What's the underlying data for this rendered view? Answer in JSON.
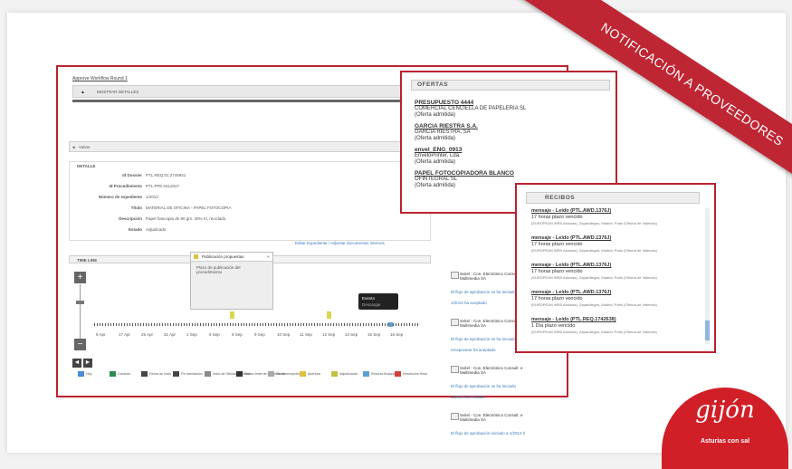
{
  "ribbon": {
    "text": "NOTIFICACIÓN A PROVEEDORES"
  },
  "workflow": {
    "header": "Approve Workflow Round 1",
    "toggle": "MOSTRAR DETALLES",
    "back": "Volver"
  },
  "detalle": {
    "title": "DETALLE",
    "rows": [
      {
        "label": "Id Dossier",
        "value": "PTL.REQ.01.2745941"
      },
      {
        "label": "Id Procedimiento",
        "value": "PTL.PFE.0412047"
      },
      {
        "label": "Número de expediente",
        "value": "1/2013"
      },
      {
        "label": "Título",
        "value": "MATERIAL DE OFICINA - PAPEL FOTOCOPIA"
      },
      {
        "label": "Descripción",
        "value": "Papel fotocopia de 80 grs. 30% Kl, reciclado"
      },
      {
        "label": "Estado",
        "value": "Adjudicado"
      }
    ],
    "link": "Editar Expediente / Adjuntar documentos internos"
  },
  "timeline": {
    "title": "TIME LINE",
    "right": "Modificar",
    "popup_title": "Publicación propuestas",
    "popup_body": "Plazo de publicación del procedimiento",
    "event_title": "Evento",
    "event_body": "Descargar",
    "dates": [
      "9 Apr",
      "17 Apr",
      "25 Apr",
      "31 Apr",
      "1 Sep",
      "9 Sep",
      "9 Sep",
      "9 Sep",
      "10 Sep",
      "11 Sep",
      "12 Sep",
      "14 Sep",
      "15 Sep",
      "16 Sep"
    ],
    "legend": [
      {
        "label": "Hoy",
        "color": "#4a8bd6"
      },
      {
        "label": "Creación",
        "color": "#2e8b57"
      },
      {
        "label": "Fecha de inicio",
        "color": "#444444"
      },
      {
        "label": "Fin tramitación",
        "color": "#444444"
      },
      {
        "label": "Inicio de Ofertas recibidas",
        "color": "#888888"
      },
      {
        "label": "Fecha límite de presentación",
        "color": "#333333"
      },
      {
        "label": "Fin de recepción",
        "color": "#aaaaaa"
      },
      {
        "label": "Apertura",
        "color": "#e0c040"
      },
      {
        "label": "Adjudicación",
        "color": "#c0c040"
      },
      {
        "label": "Recurso finalizado",
        "color": "#5aa0d0"
      },
      {
        "label": "Resolución firma",
        "color": "#d04040"
      }
    ]
  },
  "ofertas": {
    "title": "OFERTAS",
    "items": [
      {
        "name": "PRESUPUESTO 4444",
        "company": "COMERCIAL CENCIELLA DE PAPELERIA SL",
        "status": "(Oferta admitida)"
      },
      {
        "name": "GARCIA RIESTRA S.A.",
        "company": "GARCIA RIESTRA, SA",
        "status": "(Oferta admitida)"
      },
      {
        "name": "envel_ENG_0913",
        "company": "EnveloPrinter, Lda.",
        "status": "(Oferta admitida)"
      },
      {
        "name": "PAPEL FOTOCOPIADORA BLANCO",
        "company": "OFINTEGRAL SL",
        "status": "(Oferta admitida)"
      }
    ]
  },
  "recibos": {
    "title": "RECIBOS",
    "items": [
      {
        "head": "mensaje - Leído (PTL.AWD.1376J)",
        "line": "17 horas plazo vencido",
        "small": "(EUROPEAN WEB Asturias), Zapardiegos, Madrid, Paris (Oficina de Valencia)"
      },
      {
        "head": "mensaje - Leído (PTL.AWD.1376J)",
        "line": "17 horas plazo vencido",
        "small": "(EUROPEAN WEB Asturias), Zapardiegos, Madrid, Paris (Oficina de Valencia)"
      },
      {
        "head": "mensaje - Leído (PTL.AWD.1376J)",
        "line": "17 horas plazo vencido",
        "small": "(EUROPEAN WEB Asturias), Zapardiegos, Madrid, Paris (Oficina de Valencia)"
      },
      {
        "head": "mensaje - Leído (PTL.AWD.1376J)",
        "line": "17 horas plazo vencido",
        "small": "(EUROPEAN WEB Asturias), Zapardiegos, Madrid, Paris (Oficina de Valencia)"
      },
      {
        "head": "mensaje - Leído (PTL.REQ.1742638)",
        "line": "1 Día plazo vencido",
        "small": "(EUROPEAN WEB Asturias), Zapardiegos, Madrid, Paris (Oficina de Valencia)"
      }
    ]
  },
  "activity": {
    "items": [
      {
        "title": "Svitel - Con. Electrónico Consult. e Multimedia SA",
        "link": "El flujo de aprobación se ha iniciado",
        "extra": "1/2013 ha aceptado"
      },
      {
        "title": "Svitel - Con. Electrónico Consult. e Multimedia SA",
        "link": "El flujo de aprobación se ha iniciado",
        "extra": "recepcionar ha aceptado"
      },
      {
        "title": "Svitel - Con. Electrónico Consult. e Multimedia SA",
        "link": "El flujo de aprobación se ha iniciado",
        "extra": "1/2094 ha recibido"
      },
      {
        "title": "Svitel - Con. Electrónico Consult. e Multimedia SA",
        "link": "El flujo de aprobación iniciado a 1/2013 h",
        "extra": ""
      }
    ]
  },
  "logo": {
    "brand": "gijón",
    "tagline": "Asturias con sal"
  }
}
